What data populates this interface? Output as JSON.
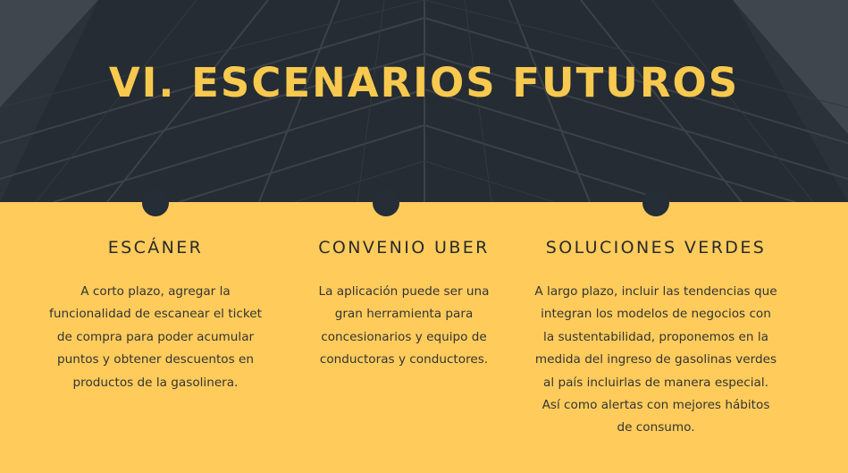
{
  "colors": {
    "hero_bg": "#2a3038",
    "accent": "#f7c94e",
    "body_bg": "#ffcc5c",
    "dot": "#252d36"
  },
  "slide": {
    "title": "VI. ESCENARIOS FUTUROS",
    "sections": [
      {
        "heading": "ESCÁNER",
        "text": "A corto plazo, agregar la\nfuncionalidad de escanear el ticket\nde compra para poder acumular\npuntos y obtener descuentos en\nproductos de la gasolinera."
      },
      {
        "heading": "CONVENIO UBER",
        "text": "La aplicación puede ser una\ngran herramienta para\nconcesionarios y equipo de\nconductoras y conductores."
      },
      {
        "heading": "SOLUCIONES VERDES",
        "text": "A largo plazo, incluir las tendencias que\nintegran los modelos de negocios con\nla sustentabilidad,  proponemos en la\nmedida del ingreso de gasolinas verdes\nal país incluirlas de manera especial.\nAsí como alertas con mejores hábitos\nde consumo."
      }
    ]
  }
}
